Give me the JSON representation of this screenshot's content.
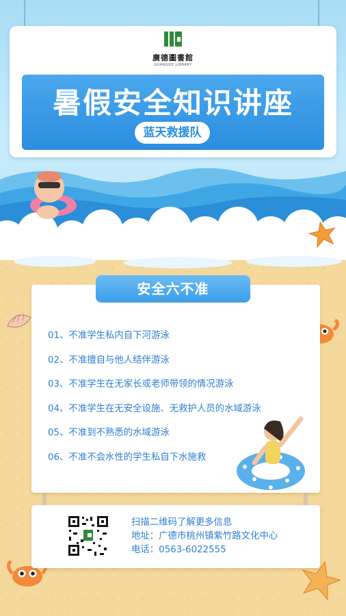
{
  "header": {
    "logo_name": "廣德圖書館",
    "logo_subtitle": "GUANGDE LIBRARY",
    "title": "暑假安全知识讲座",
    "subtitle": "蓝天救援队"
  },
  "rules": {
    "heading": "安全六不准",
    "items": [
      "01、不准学生私内自下河游泳",
      "02、不准擅自与他人结伴游泳",
      "03、不准学生在无家长或老师带领的情况游泳",
      "04、不准学生在无安全设施、无救护人员的水域游泳",
      "05、不准到不熟悉的水域游泳",
      "06、不准不会水性的学生私自下水施救"
    ]
  },
  "info": {
    "scan_text": "扫描二维码了解更多信息",
    "address": "地址：广德市桃州镇紫竹路文化中心",
    "phone": "电话：0563-6022555"
  },
  "colors": {
    "primary_blue": "#2b8ee0",
    "text_blue": "#2f7fd0",
    "sky": "#a8dcf5",
    "sand": "#f4d89c",
    "logo_green": "#2f8a3c"
  },
  "icons": [
    "library-logo-icon",
    "qr-code-icon",
    "starfish-icon",
    "crab-icon",
    "shell-icon",
    "swim-ring-icon"
  ]
}
